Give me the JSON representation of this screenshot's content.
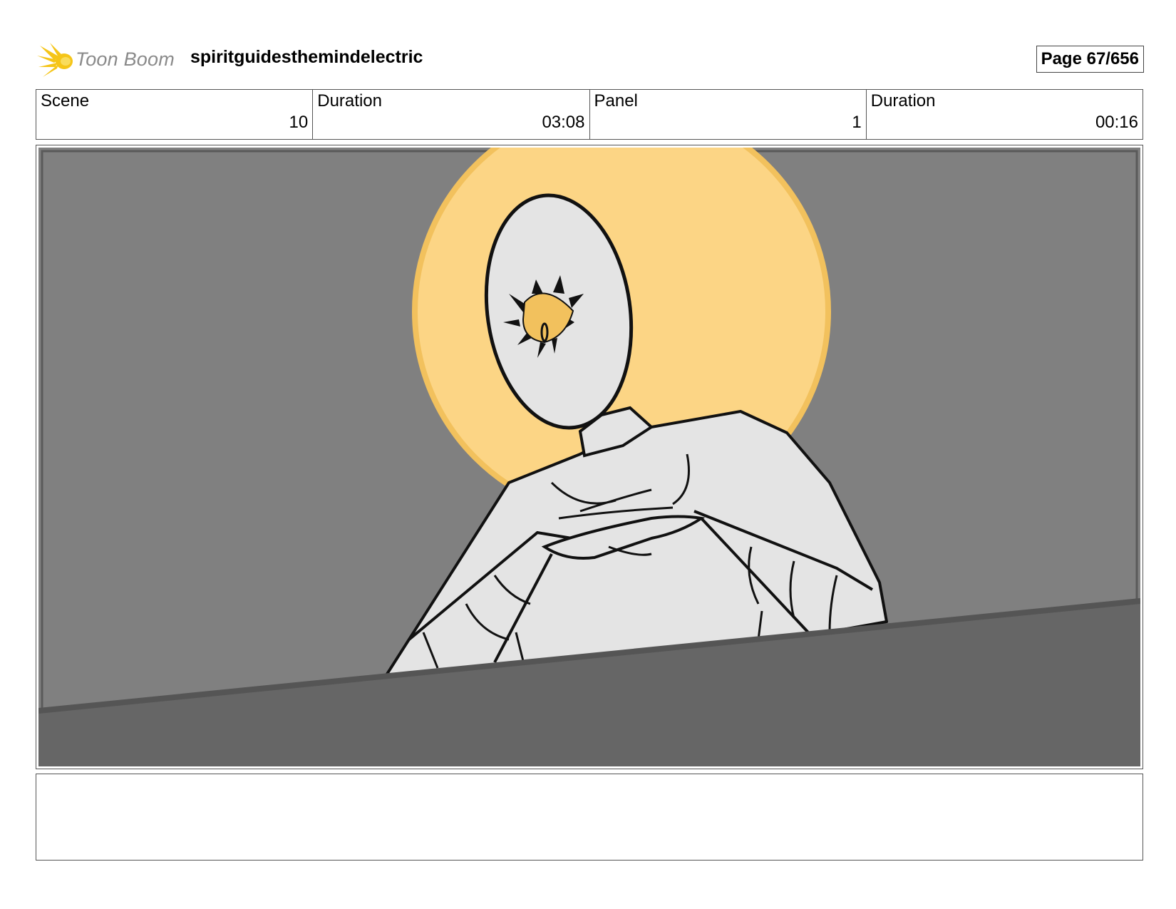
{
  "header": {
    "logo_text": "Toon Boom",
    "project_title": "spiritguidesthemindelectric",
    "page_label": "Page  67/656"
  },
  "info": {
    "scene_label": "Scene",
    "scene_value": "10",
    "scene_duration_label": "Duration",
    "scene_duration_value": "03:08",
    "panel_label": "Panel",
    "panel_value": "1",
    "panel_duration_label": "Duration",
    "panel_duration_value": "00:16"
  },
  "colors": {
    "background_gray": "#808080",
    "foreground_ledge": "#666666",
    "halo": "#fcd585",
    "halo_edge": "#f2c15d",
    "figure_fill": "#e4e4e4",
    "eye_fill": "#f2c15d"
  },
  "notes": {
    "text": ""
  }
}
